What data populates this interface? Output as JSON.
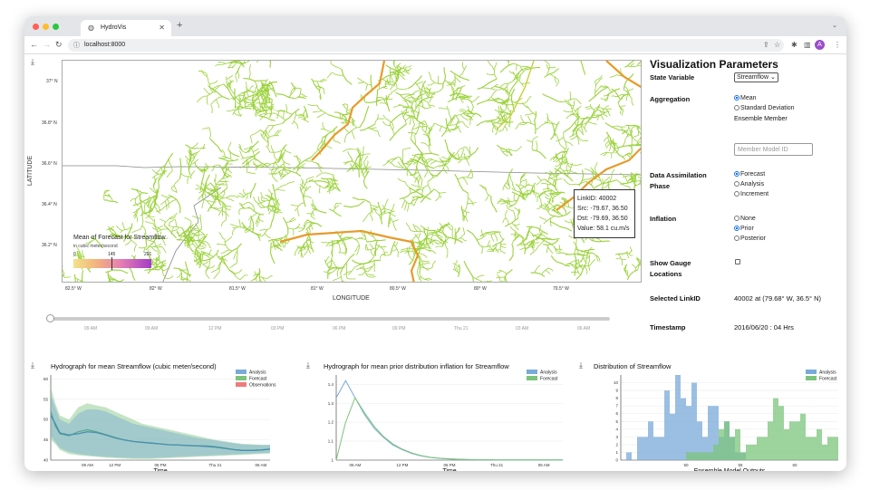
{
  "browser": {
    "tab_title": "HydroVis",
    "url": "localhost:8000",
    "avatar_letter": "A"
  },
  "map": {
    "lat_ticks": [
      "37° N",
      "36.8° N",
      "36.6° N",
      "36.4° N",
      "36.2° N"
    ],
    "lon_ticks": [
      "82.5° W",
      "82° W",
      "81.5° W",
      "81° W",
      "80.5° W",
      "80° W",
      "79.5° W"
    ],
    "ylabel": "LATITUDE",
    "xlabel": "LONGITUDE",
    "stream_color": "#9ad23a",
    "river_color": "#e89a2a",
    "legend": {
      "title": "Mean of Forecast for Streamflow",
      "unit": "in cubic meter/second",
      "ticks": [
        "0",
        "145",
        "291"
      ]
    },
    "tooltip": {
      "line1": "LinkID: 40002",
      "line2": "Src: -79.67, 36.50",
      "line3": "Dst: -79.69, 36.50",
      "line4": "Value: 58.1 cu.m/s"
    }
  },
  "timeline": {
    "ticks": [
      "09 AM",
      "09 AM",
      "12 PM",
      "03 PM",
      "06 PM",
      "09 PM",
      "Thu 21",
      "03 AM",
      "06 AM"
    ],
    "value_fraction": 0.0
  },
  "panel": {
    "title": "Visualization Parameters",
    "state_variable_label": "State Variable",
    "state_variable_value": "Streamflow",
    "aggregation_label": "Aggregation",
    "aggregation_options": [
      "Mean",
      "Standard Deviation"
    ],
    "ensemble_member_label": "Ensemble Member",
    "ensemble_member_placeholder": "Member Model ID",
    "da_phase_label_1": "Data Assimilation",
    "da_phase_label_2": "Phase",
    "da_phase_options": [
      "Forecast",
      "Analysis",
      "Increment"
    ],
    "inflation_label": "Inflation",
    "inflation_options": [
      "None",
      "Prior",
      "Posterior"
    ],
    "gauge_label_1": "Show Gauge",
    "gauge_label_2": "Locations",
    "selected_link_label": "Selected LinkID",
    "selected_link_value": "40002 at (79.68° W, 36.5° N)",
    "timestamp_label": "Timestamp",
    "timestamp_value": "2016/06/20 : 04 Hrs"
  },
  "chart_data": [
    {
      "type": "line",
      "title": "Hydrograph for mean Streamflow (cubic meter/second)",
      "xlabel": "Time",
      "ylabel": "",
      "ylim": [
        40,
        61
      ],
      "y_ticks": [
        40,
        45,
        50,
        55,
        60
      ],
      "x_ticks": [
        "09 AM",
        "12 PM",
        "06 PM",
        "Thu 21",
        "06 AM"
      ],
      "legend": [
        "Analysis",
        "Forecast",
        "Observations"
      ],
      "colors": {
        "Analysis": "#7aaad8",
        "Forecast": "#7cc47c",
        "Observations": "#ee7a7a"
      },
      "x": [
        0,
        0.5,
        1,
        2,
        3,
        4,
        5,
        6,
        7,
        8,
        9,
        10,
        11,
        12,
        13,
        14,
        15,
        16,
        17,
        18,
        19,
        20,
        21,
        22,
        23,
        24
      ],
      "series": [
        {
          "name": "Forecast",
          "values": [
            52,
            48.5,
            46.5,
            46,
            47,
            47.5,
            47,
            46.3,
            45.6,
            45,
            44.6,
            44.4,
            44.2,
            44,
            43.8,
            43.7,
            43.6,
            43.5,
            43.5,
            43.3,
            43,
            42.6,
            42.4,
            42.4,
            42.5,
            42.7
          ],
          "band_low": [
            45,
            44,
            42.5,
            41.5,
            41.2,
            41,
            40.8,
            40.6,
            40.5,
            40.4,
            40.3,
            40.3,
            40.3,
            40.4,
            40.5,
            40.6,
            40.7,
            40.8,
            40.9,
            41,
            41.1,
            41.2,
            41.3,
            41.4,
            41.5,
            41.6
          ],
          "band_high": [
            58,
            54,
            51,
            50,
            53,
            54,
            53.5,
            53,
            52,
            51,
            50,
            49,
            48.5,
            48,
            47.5,
            47,
            46.5,
            46,
            45.5,
            45,
            44.7,
            44.3,
            44,
            43.9,
            43.8,
            43.8
          ]
        },
        {
          "name": "Analysis",
          "values": [
            51,
            49,
            46.7,
            46.2,
            46.5,
            47,
            46.8,
            46.2,
            45.5,
            45,
            44.6,
            44.4,
            44.2,
            44,
            43.8,
            43.7,
            43.6,
            43.5,
            43.4,
            43.2,
            42.9,
            42.6,
            42.4,
            42.4,
            42.5,
            42.7
          ],
          "band_low": [
            46,
            44.5,
            43,
            42,
            41.5,
            41.2,
            41,
            40.8,
            40.7,
            40.6,
            40.5,
            40.5,
            40.5,
            40.6,
            40.7,
            40.8,
            40.9,
            41,
            41.1,
            41.2,
            41.3,
            41.4,
            41.5,
            41.6,
            41.7,
            41.8
          ],
          "band_high": [
            56,
            53,
            50,
            49,
            51.5,
            52.5,
            52.5,
            52,
            51,
            50,
            49,
            48.5,
            48,
            47.5,
            47,
            46.5,
            46,
            45.5,
            45.2,
            44.9,
            44.5,
            44.2,
            43.9,
            43.8,
            43.7,
            43.7
          ]
        }
      ]
    },
    {
      "type": "line",
      "title": "Hydrograph for mean prior distribution inflation for Streamflow",
      "xlabel": "Time",
      "ylabel": "",
      "ylim": [
        1,
        1.45
      ],
      "y_ticks": [
        1,
        1.1,
        1.2,
        1.3,
        1.4
      ],
      "x_ticks": [
        "06 AM",
        "12 PM",
        "06 PM",
        "Thu 21",
        "06 AM"
      ],
      "legend": [
        "Analysis",
        "Forecast"
      ],
      "colors": {
        "Analysis": "#7aaad8",
        "Forecast": "#7cc47c"
      },
      "x": [
        0,
        1,
        2,
        3,
        4,
        5,
        6,
        7,
        8,
        9,
        10,
        11,
        12,
        13,
        14,
        15,
        16,
        17,
        18,
        19,
        20,
        21,
        22,
        23,
        24
      ],
      "series": [
        {
          "name": "Analysis",
          "values": [
            1.33,
            1.42,
            1.33,
            1.24,
            1.17,
            1.12,
            1.08,
            1.055,
            1.035,
            1.022,
            1.014,
            1.009,
            1.006,
            1.004,
            1.003,
            1.002,
            1.002,
            1.001,
            1.001,
            1.001,
            1.001,
            1.001,
            1.001,
            1.001,
            1.001
          ]
        },
        {
          "name": "Forecast",
          "values": [
            1.0,
            1.2,
            1.33,
            1.25,
            1.18,
            1.125,
            1.085,
            1.058,
            1.038,
            1.024,
            1.015,
            1.01,
            1.007,
            1.005,
            1.003,
            1.002,
            1.002,
            1.001,
            1.001,
            1.001,
            1.001,
            1.001,
            1.001,
            1.001,
            1.001
          ]
        }
      ]
    },
    {
      "type": "bar",
      "title": "Distribution of Streamflow",
      "xlabel": "Ensemble Model Outputs",
      "ylabel": "",
      "ylim": [
        0,
        11
      ],
      "y_ticks": [
        0,
        1,
        2,
        3,
        4,
        5,
        6,
        7,
        8,
        9,
        10
      ],
      "x_ticks": [
        "50",
        "55",
        "60"
      ],
      "xlim": [
        44,
        64
      ],
      "bin_width": 0.5,
      "legend": [
        "Analysis",
        "Forecast"
      ],
      "colors": {
        "Analysis": "#7aaad8",
        "Forecast": "#7cc47c"
      },
      "series": [
        {
          "name": "Analysis",
          "bin_starts": [
            44.5,
            45,
            45.5,
            46,
            46.5,
            47,
            47.5,
            48,
            48.5,
            49,
            49.5,
            50,
            50.5,
            51,
            51.5,
            52,
            52.5,
            53,
            53.5,
            54,
            54.5,
            55
          ],
          "values": [
            1,
            0,
            3,
            3,
            5,
            3,
            3,
            9,
            6,
            11,
            8,
            7,
            10,
            5,
            3,
            7,
            7,
            3,
            5,
            3,
            1,
            1
          ]
        },
        {
          "name": "Forecast",
          "bin_starts": [
            48,
            49,
            49.5,
            50,
            50.5,
            51,
            51.5,
            52,
            52.5,
            53,
            53.5,
            54,
            54.5,
            55,
            55.5,
            56,
            56.5,
            57,
            57.5,
            58,
            58.5,
            59,
            59.5,
            60,
            60.5,
            61,
            61.5,
            62,
            62.5,
            63,
            63.5
          ],
          "values": [
            0,
            0,
            0,
            1,
            1,
            1,
            1,
            1,
            2,
            4,
            5,
            3,
            4,
            1,
            2,
            2,
            3,
            3,
            5,
            8,
            7,
            4,
            5,
            5,
            6,
            3,
            3,
            4,
            2,
            3,
            3
          ]
        }
      ]
    }
  ]
}
